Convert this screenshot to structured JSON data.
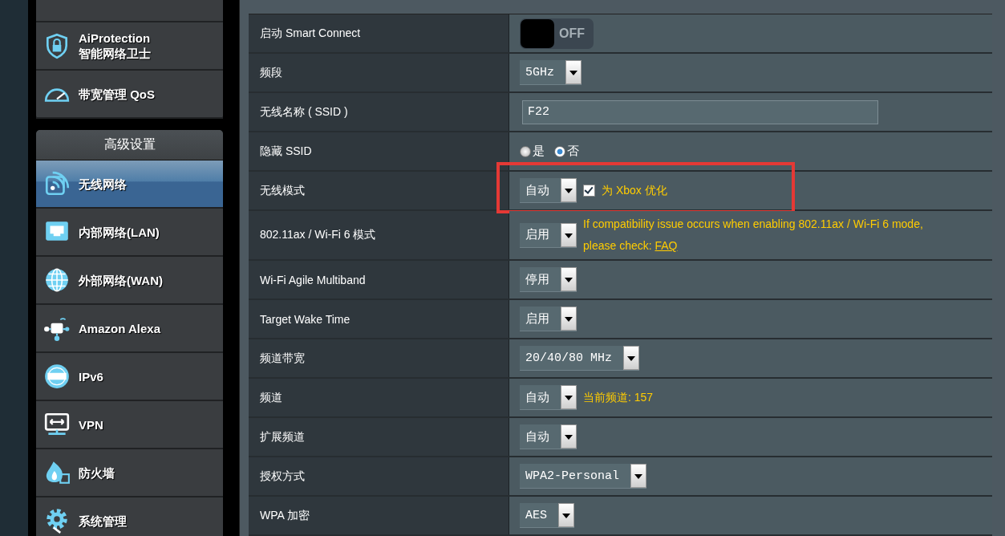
{
  "sidebar": {
    "top_items": [
      {
        "label": "AiProtection",
        "sublabel": "智能网络卫士",
        "selected": false
      },
      {
        "label": "带宽管理 QoS",
        "selected": false
      }
    ],
    "section_title": "高级设置",
    "items": [
      {
        "label": "无线网络",
        "selected": true
      },
      {
        "label": "内部网络(LAN)",
        "selected": false
      },
      {
        "label": "外部网络(WAN)",
        "selected": false
      },
      {
        "label": "Amazon Alexa",
        "selected": false
      },
      {
        "label": "IPv6",
        "selected": false
      },
      {
        "label": "VPN",
        "selected": false
      },
      {
        "label": "防火墙",
        "selected": false
      },
      {
        "label": "系统管理",
        "selected": false
      }
    ]
  },
  "settings": [
    {
      "kind": "toggle",
      "label": "启动 Smart Connect",
      "on": false,
      "toggle_text": "OFF"
    },
    {
      "kind": "select",
      "label": "频段",
      "value": "5GHz"
    },
    {
      "kind": "text",
      "label": "无线名称 ( SSID )",
      "value": "F22"
    },
    {
      "kind": "radio",
      "label": "隐藏 SSID",
      "options": [
        {
          "label": "是",
          "selected": false
        },
        {
          "label": "否",
          "selected": true
        }
      ]
    },
    {
      "kind": "select",
      "label": "无线模式",
      "value": "自动",
      "highlighted": true,
      "checkbox": {
        "label": "为 Xbox 优化",
        "checked": true
      }
    },
    {
      "kind": "select",
      "label": "802.11ax / Wi-Fi 6 模式",
      "value": "启用",
      "note": "If compatibility issue occurs when enabling 802.11ax / Wi-Fi 6 mode, please check: ",
      "link": "FAQ"
    },
    {
      "kind": "select",
      "label": "Wi-Fi Agile Multiband",
      "value": "停用"
    },
    {
      "kind": "select",
      "label": "Target Wake Time",
      "value": "启用"
    },
    {
      "kind": "select",
      "label": "频道带宽",
      "value": "20/40/80 MHz"
    },
    {
      "kind": "select",
      "label": "频道",
      "value": "自动",
      "note": "当前频道: 157"
    },
    {
      "kind": "select",
      "label": "扩展频道",
      "value": "自动"
    },
    {
      "kind": "select",
      "label": "授权方式",
      "value": "WPA2-Personal"
    },
    {
      "kind": "select",
      "label": "WPA 加密",
      "value": "AES"
    }
  ]
}
